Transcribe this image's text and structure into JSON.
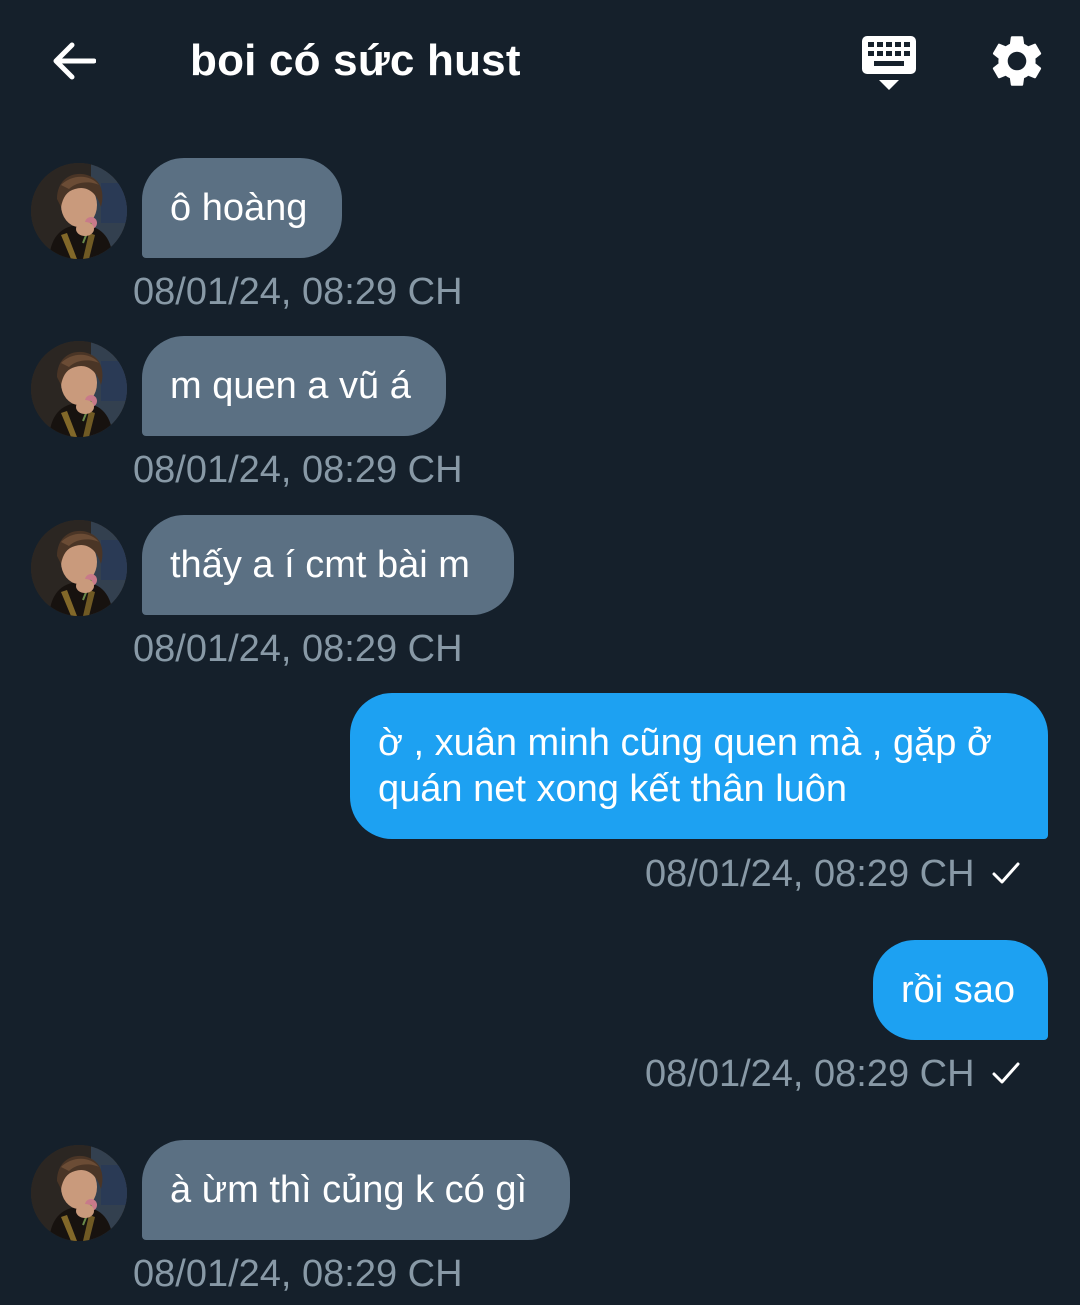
{
  "header": {
    "title": "boi có sức hust",
    "back_icon": "arrow-left-icon",
    "keyboard_icon": "keyboard-icon",
    "settings_icon": "gear-icon"
  },
  "colors": {
    "background": "#15202b",
    "incoming_bubble": "#5b7083",
    "outgoing_bubble": "#1da1f2",
    "timestamp": "#8899a6"
  },
  "messages": [
    {
      "direction": "in",
      "text": "ô hoàng",
      "time": "08/01/24, 08:29 CH"
    },
    {
      "direction": "in",
      "text": "m quen a vũ á",
      "time": "08/01/24, 08:29 CH"
    },
    {
      "direction": "in",
      "text": "thấy a í cmt bài m",
      "time": "08/01/24, 08:29 CH"
    },
    {
      "direction": "out",
      "text": "ờ , xuân minh cũng quen mà , gặp ở quán net xong kết thân luôn",
      "time": "08/01/24, 08:29 CH",
      "status_icon": "check-icon"
    },
    {
      "direction": "out",
      "text": "rồi sao",
      "time": "08/01/24, 08:29 CH",
      "status_icon": "check-icon"
    },
    {
      "direction": "in",
      "text": "à ừm thì củng k có gì",
      "time": "08/01/24, 08:29 CH"
    }
  ]
}
